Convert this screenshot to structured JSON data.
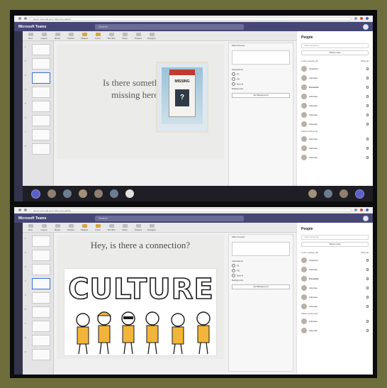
{
  "windows": [
    {
      "browser_url": "teams.microsoft.com/_#/pre-join-calling/",
      "app_title": "Microsoft Teams",
      "search_placeholder": "Search",
      "toolbar": [
        "New",
        "Layout",
        "Reset",
        "Section",
        "Shapes",
        "Icons",
        "Text Box",
        "Draw",
        "Present",
        "Designer"
      ],
      "slide_title": "Is there something missing here?",
      "poster_word": "MISSING",
      "poster_mark": "?",
      "panel": {
        "preview_label": "Slide Preview",
        "heading": "Appearance",
        "options": [
          "Fit",
          "Fill",
          "Best fit"
        ],
        "background_label": "Background",
        "button": "Set Background"
      },
      "people": {
        "title": "People",
        "search_placeholder": "Invite someone",
        "invite_label": "Share invite",
        "section_in_meeting": "In the meeting (9)",
        "mute_all": "Mute all",
        "section_others": "Others invited (3)",
        "list": [
          {
            "name": "Organizer",
            "role": ""
          },
          {
            "name": "Attendee",
            "role": ""
          },
          {
            "name": "Presenter",
            "role": "Presenter"
          },
          {
            "name": "Attendee",
            "role": ""
          },
          {
            "name": "Attendee",
            "role": ""
          },
          {
            "name": "Attendee",
            "role": ""
          },
          {
            "name": "Attendee",
            "role": ""
          },
          {
            "name": "Attendee",
            "role": ""
          },
          {
            "name": "Attendee",
            "role": ""
          },
          {
            "name": "Attendee",
            "role": ""
          }
        ]
      }
    },
    {
      "browser_url": "teams.microsoft.com/_#/pre-join-calling/",
      "app_title": "Microsoft Teams",
      "search_placeholder": "Search",
      "toolbar": [
        "New",
        "Layout",
        "Reset",
        "Section",
        "Shapes",
        "Icons",
        "Text Box",
        "Draw",
        "Present",
        "Designer"
      ],
      "slide_title": "Hey, is there a connection?",
      "art_word": "CULTURE",
      "panel": {
        "preview_label": "Slide Preview",
        "heading": "Appearance",
        "options": [
          "Fit",
          "Fill",
          "Best fit"
        ],
        "background_label": "Background",
        "button": "Set Background"
      },
      "people": {
        "title": "People",
        "search_placeholder": "Invite someone",
        "invite_label": "Share invite",
        "section_in_meeting": "In the meeting (9)",
        "mute_all": "Mute all",
        "section_others": "Others invited (3)",
        "list": [
          {
            "name": "Organizer",
            "role": ""
          },
          {
            "name": "Attendee",
            "role": ""
          },
          {
            "name": "Presenter",
            "role": "Presenter"
          },
          {
            "name": "Attendee",
            "role": ""
          },
          {
            "name": "Attendee",
            "role": ""
          },
          {
            "name": "Attendee",
            "role": ""
          },
          {
            "name": "Attendee",
            "role": ""
          },
          {
            "name": "Attendee",
            "role": ""
          }
        ]
      }
    }
  ],
  "colors": {
    "teams_bar": "#464775",
    "accent": "#5b5fc7",
    "frame": "#6e6d3c"
  }
}
